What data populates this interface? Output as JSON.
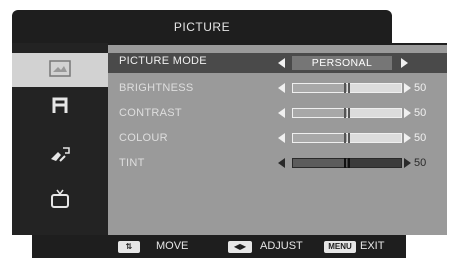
{
  "menu": {
    "title": "PICTURE"
  },
  "sidebar": {
    "items": [
      {
        "icon": "picture-icon",
        "active": true
      },
      {
        "icon": "sound-icon",
        "active": false
      },
      {
        "icon": "setup-icon",
        "active": false
      },
      {
        "icon": "tv-icon",
        "active": false
      }
    ]
  },
  "settings": {
    "picture_mode": {
      "label": "PICTURE MODE",
      "value": "PERSONAL"
    },
    "brightness": {
      "label": "BRIGHTNESS",
      "value": "50",
      "level": 0.5
    },
    "contrast": {
      "label": "CONTRAST",
      "value": "50",
      "level": 0.5
    },
    "colour": {
      "label": "COLOUR",
      "value": "50",
      "level": 0.5
    },
    "tint": {
      "label": "TINT",
      "value": "50",
      "level": 0.5
    }
  },
  "footer": {
    "move": {
      "key": "⇅",
      "label": "MOVE"
    },
    "adjust": {
      "key": "◀▶",
      "label": "ADJUST"
    },
    "exit": {
      "key": "MENU",
      "label": "EXIT"
    }
  },
  "colors": {
    "panel": "#9a9a9a",
    "dark": "#1e1e1e",
    "selected_row": "#4a4a4a"
  }
}
